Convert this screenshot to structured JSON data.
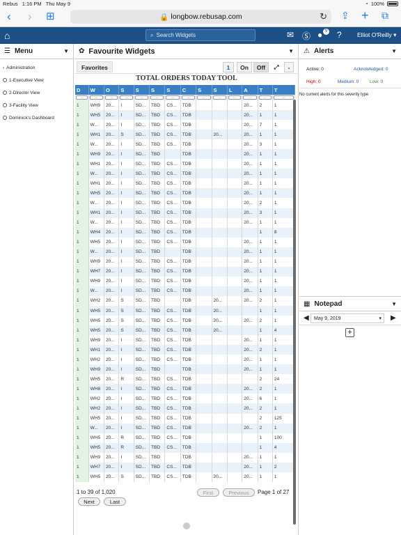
{
  "status": {
    "carrier": "Rebus",
    "time": "1:16 PM",
    "date": "Thu May 9",
    "battery": "100%"
  },
  "browser": {
    "url": "longbow.rebusap.com"
  },
  "topnav": {
    "search_placeholder": "Search Widgets",
    "notif_count": "9",
    "user": "Elliot O'Reilly"
  },
  "menu": {
    "title": "Menu",
    "items": [
      {
        "label": "Administration"
      },
      {
        "label": "1-Executive View"
      },
      {
        "label": "2-Director View"
      },
      {
        "label": "3-Facility View"
      },
      {
        "label": "Dominick's Dashboard"
      }
    ]
  },
  "widgets": {
    "title": "Favourite Widgets",
    "tab": "Favorites",
    "num": "1",
    "on": "On",
    "off": "Off",
    "minus": "-"
  },
  "tool": {
    "title": "TOTAL ORDERS TODAY TOOL",
    "columns": [
      "D",
      "W",
      "O",
      "S",
      "S",
      "S",
      "S",
      "C",
      "S",
      "S",
      "L",
      "A",
      "T",
      "T"
    ],
    "filter": "...",
    "rows": [
      [
        "1",
        "WH9",
        "20...",
        "I",
        "SD...",
        "TBD",
        "CS...",
        "TDB",
        "",
        "",
        "",
        "20...",
        "2",
        "1"
      ],
      [
        "1",
        "WH5",
        "20...",
        "I",
        "SD...",
        "TBD",
        "CS...",
        "TDB",
        "",
        "",
        "",
        "20...",
        "1",
        "1"
      ],
      [
        "1",
        "W...",
        "20...",
        "I",
        "SD...",
        "TBD",
        "CS...",
        "TDB",
        "",
        "",
        "",
        "20...",
        "7",
        "1"
      ],
      [
        "1",
        "WH1",
        "20...",
        "S",
        "SD...",
        "TBD",
        "CS...",
        "TDB",
        "",
        "20...",
        "",
        "20...",
        "1",
        "1"
      ],
      [
        "1",
        "W...",
        "20...",
        "I",
        "SD...",
        "TBD",
        "CS...",
        "TDB",
        "",
        "",
        "",
        "20...",
        "3",
        "1"
      ],
      [
        "1",
        "WH9",
        "20...",
        "I",
        "SD...",
        "TBD",
        "",
        "TDB",
        "",
        "",
        "",
        "20...",
        "1",
        "1"
      ],
      [
        "1",
        "WH1",
        "20...",
        "I",
        "SD...",
        "TBD",
        "CS...",
        "TDB",
        "",
        "",
        "",
        "20...",
        "1",
        "1"
      ],
      [
        "1",
        "W...",
        "20...",
        "I",
        "SD...",
        "TBD",
        "CS...",
        "TDB",
        "",
        "",
        "",
        "20...",
        "1",
        "1"
      ],
      [
        "1",
        "WH1",
        "20...",
        "I",
        "SD...",
        "TBD",
        "CS...",
        "TDB",
        "",
        "",
        "",
        "20...",
        "1",
        "1"
      ],
      [
        "1",
        "WH5",
        "20...",
        "I",
        "SD...",
        "TBD",
        "CS...",
        "TDB",
        "",
        "",
        "",
        "20...",
        "1",
        "1"
      ],
      [
        "1",
        "W...",
        "20...",
        "I",
        "SD...",
        "TBD",
        "CS...",
        "TDB",
        "",
        "",
        "",
        "20...",
        "2",
        "1"
      ],
      [
        "1",
        "WH1",
        "20...",
        "I",
        "SD...",
        "TBD",
        "CS...",
        "TDB",
        "",
        "",
        "",
        "20...",
        "3",
        "1"
      ],
      [
        "1",
        "W...",
        "20...",
        "I",
        "SD...",
        "TBD",
        "CS...",
        "TDB",
        "",
        "",
        "",
        "20...",
        "1",
        "1"
      ],
      [
        "1",
        "WH4",
        "20...",
        "I",
        "SD...",
        "TBD",
        "CS...",
        "TDB",
        "",
        "",
        "",
        "",
        "1",
        "8"
      ],
      [
        "1",
        "WH5",
        "20...",
        "I",
        "SD...",
        "TBD",
        "CS...",
        "TDB",
        "",
        "",
        "",
        "20...",
        "1",
        "1"
      ],
      [
        "1",
        "W...",
        "20...",
        "I",
        "SD...",
        "TBD",
        "",
        "TDB",
        "",
        "",
        "",
        "20...",
        "1",
        "1"
      ],
      [
        "1",
        "WH9",
        "20...",
        "I",
        "SD...",
        "TBD",
        "CS...",
        "TDB",
        "",
        "",
        "",
        "20...",
        "1",
        "1"
      ],
      [
        "1",
        "WH7",
        "20...",
        "I",
        "SD...",
        "TBD",
        "CS...",
        "TDB",
        "",
        "",
        "",
        "20...",
        "1",
        "1"
      ],
      [
        "1",
        "WH9",
        "20...",
        "I",
        "SD...",
        "TBD",
        "CS...",
        "TDB",
        "",
        "",
        "",
        "20...",
        "1",
        "1"
      ],
      [
        "1",
        "W...",
        "20...",
        "I",
        "SD...",
        "TBD",
        "CS...",
        "TDB",
        "",
        "",
        "",
        "20...",
        "1",
        "1"
      ],
      [
        "1",
        "WH2",
        "20...",
        "S",
        "SD...",
        "TBD",
        "",
        "TDB",
        "",
        "20...",
        "",
        "20...",
        "2",
        "1"
      ],
      [
        "1",
        "WH5",
        "20...",
        "S",
        "SD...",
        "TBD",
        "CS...",
        "TDB",
        "",
        "20...",
        "",
        "",
        "1",
        "1"
      ],
      [
        "1",
        "WH5",
        "20...",
        "S",
        "SD...",
        "TBD",
        "CS...",
        "TDB",
        "",
        "20...",
        "",
        "20...",
        "2",
        "1"
      ],
      [
        "1",
        "WH5",
        "20...",
        "S",
        "SD...",
        "TBD",
        "CS...",
        "TDB",
        "",
        "20...",
        "",
        "",
        "1",
        "4"
      ],
      [
        "1",
        "WH9",
        "20...",
        "I",
        "SD...",
        "TBD",
        "CS...",
        "TDB",
        "",
        "",
        "",
        "20...",
        "1",
        "1"
      ],
      [
        "1",
        "WH1",
        "20...",
        "I",
        "SD...",
        "TBD",
        "CS...",
        "TDB",
        "",
        "",
        "",
        "20...",
        "2",
        "1"
      ],
      [
        "1",
        "WH2",
        "20...",
        "I",
        "SD...",
        "TBD",
        "CS...",
        "TDB",
        "",
        "",
        "",
        "20...",
        "1",
        "1"
      ],
      [
        "1",
        "WH9",
        "20...",
        "I",
        "SD...",
        "TBD",
        "",
        "TDB",
        "",
        "",
        "",
        "20...",
        "1",
        "1"
      ],
      [
        "1",
        "WH5",
        "20...",
        "R",
        "SD...",
        "TBD",
        "CS...",
        "TDB",
        "",
        "",
        "",
        "",
        "2",
        "24"
      ],
      [
        "1",
        "WH8",
        "20...",
        "I",
        "SD...",
        "TBD",
        "CS...",
        "TDB",
        "",
        "",
        "",
        "20...",
        "2",
        "1"
      ],
      [
        "1",
        "WH2",
        "20...",
        "I",
        "SD...",
        "TBD",
        "CS...",
        "TDB",
        "",
        "",
        "",
        "20...",
        "6",
        "1"
      ],
      [
        "1",
        "WH2",
        "20...",
        "I",
        "SD...",
        "TBD",
        "CS...",
        "TDB",
        "",
        "",
        "",
        "20...",
        "2",
        "1"
      ],
      [
        "1",
        "WH5",
        "20...",
        "I",
        "SD...",
        "TBD",
        "CS...",
        "TDB",
        "",
        "",
        "",
        "",
        "2",
        "125"
      ],
      [
        "1",
        "W...",
        "20...",
        "I",
        "SD...",
        "TBD",
        "CS...",
        "TDB",
        "",
        "",
        "",
        "20...",
        "2",
        "1"
      ],
      [
        "1",
        "WH5",
        "20...",
        "R",
        "SD...",
        "TBD",
        "CS...",
        "TDB",
        "",
        "",
        "",
        "",
        "1",
        "100"
      ],
      [
        "1",
        "WH5",
        "20...",
        "R",
        "SD...",
        "TBD",
        "CS...",
        "TDB",
        "",
        "",
        "",
        "",
        "1",
        "4"
      ],
      [
        "1",
        "WH9",
        "20...",
        "I",
        "SD...",
        "TBD",
        "",
        "TDB",
        "",
        "",
        "",
        "20...",
        "1",
        "1"
      ],
      [
        "1",
        "WH7",
        "20...",
        "I",
        "SD...",
        "TBD",
        "CS...",
        "TDB",
        "",
        "",
        "",
        "20...",
        "1",
        "2"
      ],
      [
        "1",
        "WH5",
        "20...",
        "S",
        "SD...",
        "TBD",
        "CS...",
        "TDB",
        "",
        "20...",
        "",
        "20...",
        "1",
        "1"
      ]
    ],
    "range": "1 to 39 of 1,020",
    "first": "First",
    "previous": "Previous",
    "page": "Page 1 of 27",
    "next": "Next",
    "last": "Last"
  },
  "alerts": {
    "title": "Alerts",
    "active": "Active: 0",
    "acknowledged": "Acknowledged: 0",
    "high": "High: 0",
    "medium": "Medium: 0",
    "low": "Low: 0",
    "empty": "No current alerts for this severity type"
  },
  "notepad": {
    "title": "Notepad",
    "date": "May 9, 2019"
  }
}
